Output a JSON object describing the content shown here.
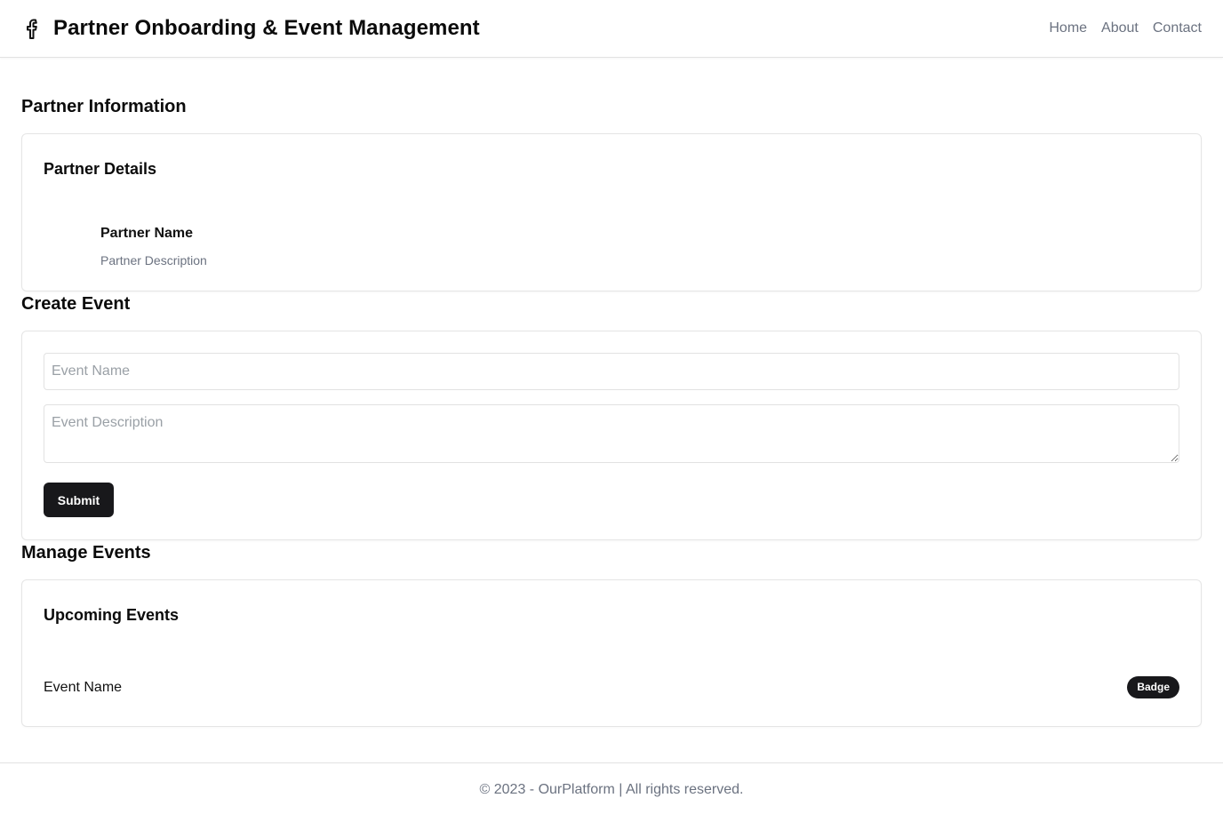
{
  "header": {
    "brand_icon": "facebook-icon",
    "title": "Partner Onboarding & Event Management",
    "nav": [
      {
        "label": "Home"
      },
      {
        "label": "About"
      },
      {
        "label": "Contact"
      }
    ]
  },
  "partner_section": {
    "title": "Partner Information",
    "card_title": "Partner Details",
    "partner_name": "Partner Name",
    "partner_description": "Partner Description"
  },
  "create_event": {
    "title": "Create Event",
    "event_name_placeholder": "Event Name",
    "event_name_value": "",
    "event_description_placeholder": "Event Description",
    "event_description_value": "",
    "submit_label": "Submit",
    "submit_color": "#18181b"
  },
  "manage_events": {
    "title": "Manage Events",
    "card_title": "Upcoming Events",
    "events": [
      {
        "name": "Event Name",
        "badge": "Badge"
      }
    ]
  },
  "footer": {
    "text": "© 2023 - OurPlatform | All rights reserved."
  }
}
